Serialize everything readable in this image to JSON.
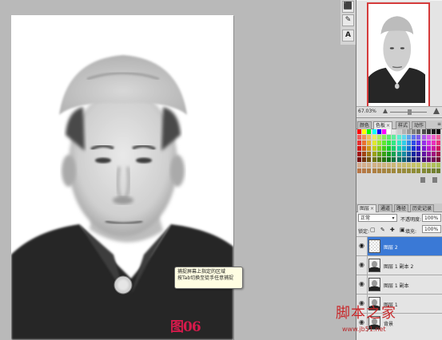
{
  "canvas": {
    "tooltip_lines": [
      "捕捉屏幕上指定的区域",
      "按Tab切换至徒手任意捕捉"
    ],
    "figure_label": "图06"
  },
  "tools": [
    {
      "glyph": "⬛",
      "icon": "fill-tool-icon"
    },
    {
      "glyph": "✎",
      "icon": "brush-tool-icon"
    },
    {
      "glyph": "A",
      "icon": "type-tool-icon"
    }
  ],
  "navigator": {
    "zoom": "67.03%"
  },
  "color_tabs": [
    {
      "label": "颜色",
      "active": false
    },
    {
      "label": "色板",
      "active": true
    },
    {
      "label": "样式",
      "active": false
    },
    {
      "label": "动作",
      "active": false
    }
  ],
  "layer_tabs": [
    {
      "label": "图层",
      "active": true
    },
    {
      "label": "通道",
      "active": false
    },
    {
      "label": "路径",
      "active": false
    },
    {
      "label": "历史记录",
      "active": false
    }
  ],
  "layers_panel": {
    "blend_mode": "正常",
    "opacity_label": "不透明度:",
    "opacity_value": "100%",
    "lock_label": "锁定:",
    "lock_icons": "▢ ✎ ✚ ▣",
    "fill_label": "填充:",
    "fill_value": "100%",
    "layers": [
      {
        "name": "图层 2",
        "selected": true,
        "thumb": "blank"
      },
      {
        "name": "图层 1 副本 2",
        "selected": false,
        "thumb": "photo"
      },
      {
        "name": "图层 1 副本",
        "selected": false,
        "thumb": "photo"
      },
      {
        "name": "图层 1",
        "selected": false,
        "thumb": "photo"
      },
      {
        "name": "背景",
        "selected": false,
        "thumb": "photo"
      }
    ]
  },
  "watermark": {
    "main": "脚本之家",
    "url": "www.jb51.net"
  },
  "colors": {
    "accent_selected": "#3a79d6",
    "navigator_frame": "#d53b3b",
    "label_red": "#d41a4b"
  }
}
